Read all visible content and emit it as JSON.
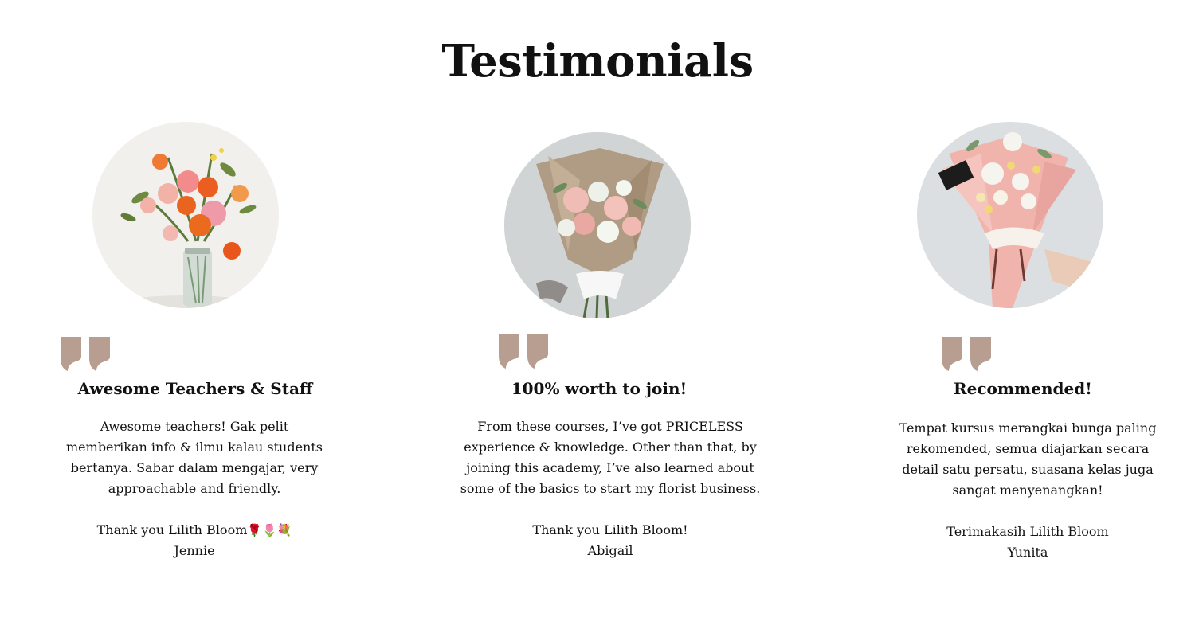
{
  "page": {
    "title": "Testimonials"
  },
  "colors": {
    "quote_mark": "#b89d91",
    "text": "#111111",
    "background": "#ffffff"
  },
  "icons": {
    "quote": "quote-mark-icon"
  },
  "testimonials": [
    {
      "photo": "orange-pink-bouquet-in-jar",
      "title": "Awesome Teachers & Staff",
      "body": "Awesome teachers! Gak pelit memberikan info & ilmu kalau students bertanya. Sabar dalam mengajar, very approachable and friendly.",
      "thanks": "Thank you Lilith Bloom",
      "emoji": "🌹🌷💐",
      "author": "Jennie"
    },
    {
      "photo": "pastel-bouquet-in-kraft-paper",
      "title": "100% worth to join!",
      "body": "From these courses, I’ve got PRICELESS experience & knowledge. Other than that, by joining this academy, I’ve also learned about some of the basics to start my florist business.",
      "thanks": "Thank you Lilith Bloom!",
      "author": "Abigail"
    },
    {
      "photo": "white-bouquet-in-pink-paper",
      "title": "Recommended!",
      "body": "Tempat kursus merangkai bunga paling rekomended, semua diajarkan secara detail satu persatu, suasana kelas juga sangat menyenangkan!",
      "thanks": "Terimakasih Lilith Bloom",
      "author": "Yunita"
    }
  ]
}
